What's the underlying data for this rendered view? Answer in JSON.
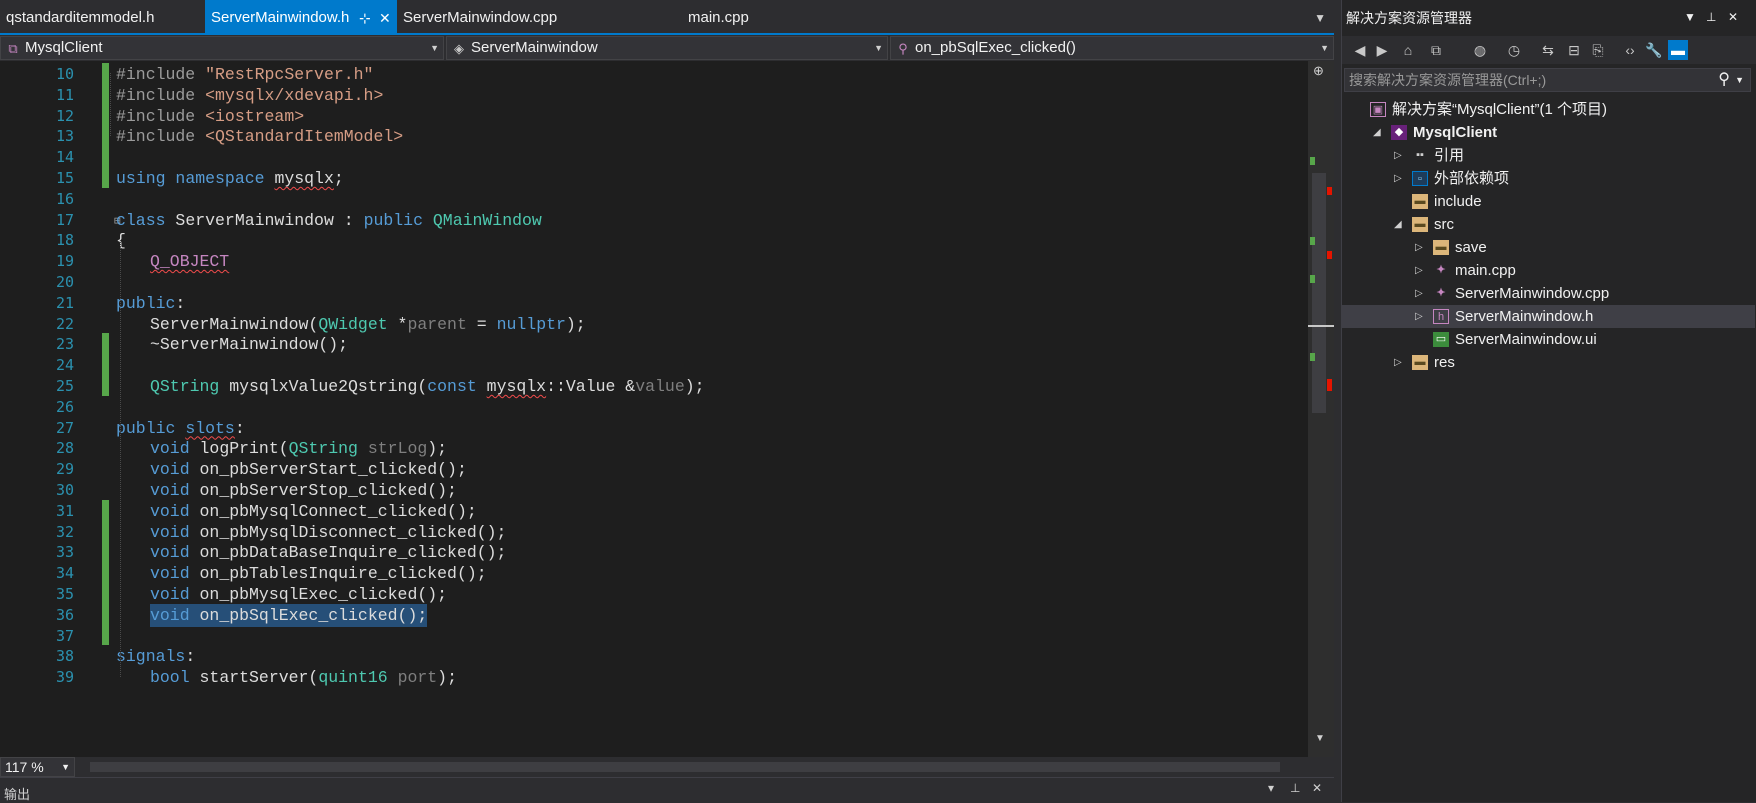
{
  "tabs": [
    {
      "label": "qstandarditemmodel.h",
      "active": false
    },
    {
      "label": "ServerMainwindow.h",
      "active": true
    },
    {
      "label": "ServerMainwindow.cpp",
      "active": false
    },
    {
      "label": "main.cpp",
      "active": false
    }
  ],
  "nav": {
    "project": "MysqlClient",
    "scope": "ServerMainwindow",
    "member": "on_pbSqlExec_clicked()"
  },
  "editor": {
    "lines": [
      {
        "n": "10",
        "text": "#include \"RestRpcServer.h\""
      },
      {
        "n": "11",
        "text": "#include <mysqlx/xdevapi.h>"
      },
      {
        "n": "12",
        "text": "#include <iostream>"
      },
      {
        "n": "13",
        "text": "#include <QStandardItemModel>"
      },
      {
        "n": "14",
        "text": ""
      },
      {
        "n": "15",
        "text": "using namespace mysqlx;"
      },
      {
        "n": "16",
        "text": ""
      },
      {
        "n": "17",
        "text": "class ServerMainwindow : public QMainWindow"
      },
      {
        "n": "18",
        "text": "{"
      },
      {
        "n": "19",
        "text": "Q_OBJECT"
      },
      {
        "n": "20",
        "text": ""
      },
      {
        "n": "21",
        "text": "public:"
      },
      {
        "n": "22",
        "text": "ServerMainwindow(QWidget *parent = nullptr);"
      },
      {
        "n": "23",
        "text": "~ServerMainwindow();"
      },
      {
        "n": "24",
        "text": ""
      },
      {
        "n": "25",
        "text": "QString mysqlxValue2Qstring(const mysqlx::Value &value);"
      },
      {
        "n": "26",
        "text": ""
      },
      {
        "n": "27",
        "text": "public slots:"
      },
      {
        "n": "28",
        "text": "void logPrint(QString strLog);"
      },
      {
        "n": "29",
        "text": "void on_pbServerStart_clicked();"
      },
      {
        "n": "30",
        "text": "void on_pbServerStop_clicked();"
      },
      {
        "n": "31",
        "text": "void on_pbMysqlConnect_clicked();"
      },
      {
        "n": "32",
        "text": "void on_pbMysqlDisconnect_clicked();"
      },
      {
        "n": "33",
        "text": "void on_pbDataBaseInquire_clicked();"
      },
      {
        "n": "34",
        "text": "void on_pbTablesInquire_clicked();"
      },
      {
        "n": "35",
        "text": "void on_pbMysqlExec_clicked();"
      },
      {
        "n": "36",
        "text": "void on_pbSqlExec_clicked();"
      },
      {
        "n": "37",
        "text": ""
      },
      {
        "n": "38",
        "text": "signals:"
      },
      {
        "n": "39",
        "text": "bool startServer(quint16 port);"
      }
    ]
  },
  "zoom": "117 %",
  "output_panel": {
    "title": "输出"
  },
  "solution_explorer": {
    "title": "解决方案资源管理器",
    "search_placeholder": "搜索解决方案资源管理器(Ctrl+;)",
    "items": [
      {
        "label": "解决方案“MysqlClient”(1 个项目)",
        "icon": "solution-icon"
      },
      {
        "label": "MysqlClient",
        "icon": "project-icon"
      },
      {
        "label": "引用",
        "icon": "references-icon"
      },
      {
        "label": "外部依赖项",
        "icon": "external-dependencies-icon"
      },
      {
        "label": "include",
        "icon": "folder-icon"
      },
      {
        "label": "src",
        "icon": "folder-icon"
      },
      {
        "label": "save",
        "icon": "folder-icon"
      },
      {
        "label": "main.cpp",
        "icon": "cpp-file-icon"
      },
      {
        "label": "ServerMainwindow.cpp",
        "icon": "cpp-file-icon"
      },
      {
        "label": "ServerMainwindow.h",
        "icon": "header-file-icon"
      },
      {
        "label": "ServerMainwindow.ui",
        "icon": "ui-file-icon"
      },
      {
        "label": "res",
        "icon": "folder-icon"
      }
    ]
  },
  "colors": {
    "accent": "#007acc",
    "editor_bg": "#1e1e1e",
    "keyword": "#569cd6",
    "type": "#4ec9b0",
    "string": "#d69d85",
    "line_number": "#2b91af",
    "change_margin": "#57a64a",
    "selection": "#264f78"
  }
}
